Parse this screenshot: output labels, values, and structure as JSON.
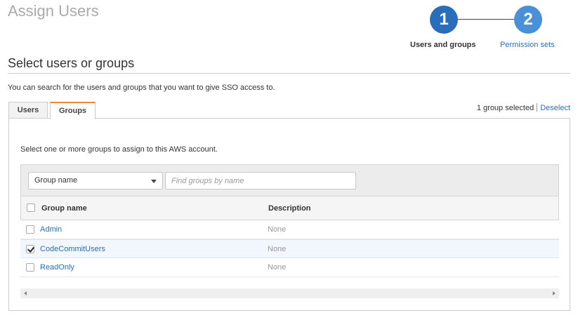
{
  "page": {
    "title": "Assign Users"
  },
  "stepper": {
    "steps": [
      {
        "number": "1",
        "label": "Users and groups"
      },
      {
        "number": "2",
        "label": "Permission sets"
      }
    ]
  },
  "section": {
    "title": "Select users or groups",
    "intro": "You can search for the users and groups that you want to give SSO access to."
  },
  "tabs": [
    {
      "label": "Users",
      "active": false
    },
    {
      "label": "Groups",
      "active": true
    }
  ],
  "selection": {
    "status": "1 group selected",
    "deselect_label": "Deselect"
  },
  "panel": {
    "description": "Select one or more groups to assign to this AWS account.",
    "filter": {
      "attribute": "Group name",
      "placeholder": "Find groups by name"
    }
  },
  "table": {
    "columns": [
      "Group name",
      "Description"
    ],
    "rows": [
      {
        "name": "Admin",
        "description": "None",
        "selected": false
      },
      {
        "name": "CodeCommitUsers",
        "description": "None",
        "selected": true
      },
      {
        "name": "ReadOnly",
        "description": "None",
        "selected": false
      }
    ]
  },
  "colors": {
    "accent": "#2a6ebb",
    "step_inactive": "#4a90d9",
    "tab_active_border": "#e88d3c",
    "selected_row": "#f1f7fc"
  },
  "icons": {
    "dropdown": "chevron-down-icon",
    "scroll_left": "arrow-left-icon",
    "scroll_right": "arrow-right-icon",
    "checkmark": "check-icon"
  }
}
